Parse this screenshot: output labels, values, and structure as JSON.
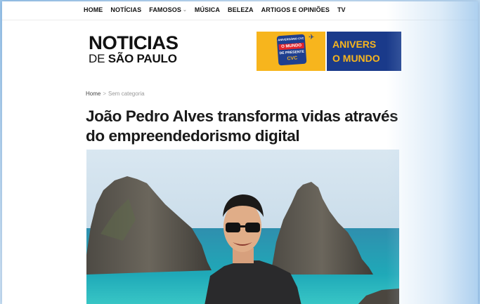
{
  "nav": {
    "items": [
      {
        "label": "HOME"
      },
      {
        "label": "NOTÍCIAS"
      },
      {
        "label": "FAMOSOS",
        "has_dropdown": true
      },
      {
        "label": "MÚSICA"
      },
      {
        "label": "BELEZA"
      },
      {
        "label": "ARTIGOS E OPINIÕES"
      },
      {
        "label": "TV"
      }
    ],
    "dropdown_icon": "chevron-down-icon"
  },
  "logo": {
    "line1": "NOTICIAS",
    "line2_prefix": "DE",
    "line2_bold": "SÃO PAULO"
  },
  "banner": {
    "badge_top": "ANIVERSÁRIO CVC",
    "badge_mid": "O MUNDO",
    "badge_low": "DE PRESENTE",
    "badge_brand": "CVC",
    "right_line1": "ANIVERS",
    "right_line2": "O MUNDO",
    "colors": {
      "yellow": "#f7b51d",
      "navy": "#1a3a8a",
      "red": "#e3242b"
    }
  },
  "breadcrumb": {
    "home": "Home",
    "separator": ">",
    "current": "Sem categoria"
  },
  "article": {
    "title": "João Pedro Alves transforma vidas através do empreendedorismo digital"
  }
}
